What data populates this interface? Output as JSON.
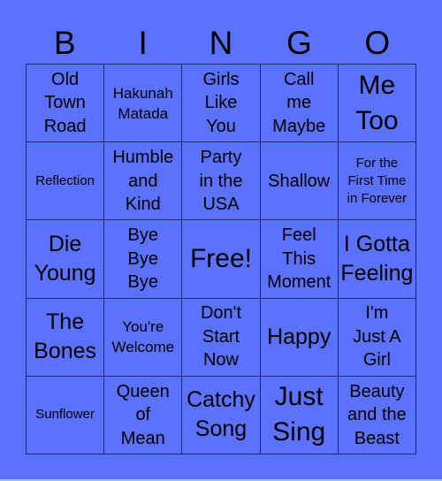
{
  "header": {
    "letters": [
      "B",
      "I",
      "N",
      "G",
      "O"
    ]
  },
  "colors": {
    "background": "#5b72fe",
    "border": "#1b2a6e",
    "text": "#000000"
  },
  "card": {
    "rows": [
      [
        {
          "text": "Old Town Road",
          "lines": [
            "Old",
            "Town",
            "Road"
          ]
        },
        {
          "text": "Hakunah Matada",
          "lines": [
            "Hakunah",
            "Matada"
          ]
        },
        {
          "text": "Girls Like You",
          "lines": [
            "Girls",
            "Like",
            "You"
          ]
        },
        {
          "text": "Call me Maybe",
          "lines": [
            "Call",
            "me",
            "Maybe"
          ]
        },
        {
          "text": "Me Too",
          "lines": [
            "Me",
            "Too"
          ]
        }
      ],
      [
        {
          "text": "Reflection",
          "lines": [
            "Reflection"
          ]
        },
        {
          "text": "Humble and Kind",
          "lines": [
            "Humble",
            "and",
            "Kind"
          ]
        },
        {
          "text": "Party in the USA",
          "lines": [
            "Party",
            "in the",
            "USA"
          ]
        },
        {
          "text": "Shallow",
          "lines": [
            "Shallow"
          ]
        },
        {
          "text": "For the First Time in Forever",
          "lines": [
            "For the",
            "First Time",
            "in Forever"
          ]
        }
      ],
      [
        {
          "text": "Die Young",
          "lines": [
            "Die",
            "Young"
          ]
        },
        {
          "text": "Bye Bye Bye",
          "lines": [
            "Bye",
            "Bye",
            "Bye"
          ]
        },
        {
          "text": "Free!",
          "lines": [
            "Free!"
          ]
        },
        {
          "text": "Feel This Moment",
          "lines": [
            "Feel",
            "This",
            "Moment"
          ]
        },
        {
          "text": "I Gotta Feeling",
          "lines": [
            "I Gotta",
            "Feeling"
          ]
        }
      ],
      [
        {
          "text": "The Bones",
          "lines": [
            "The",
            "Bones"
          ]
        },
        {
          "text": "You're Welcome",
          "lines": [
            "You're",
            "Welcome"
          ]
        },
        {
          "text": "Don't Start Now",
          "lines": [
            "Don't",
            "Start",
            "Now"
          ]
        },
        {
          "text": "Happy",
          "lines": [
            "Happy"
          ]
        },
        {
          "text": "I'm Just A Girl",
          "lines": [
            "I'm",
            "Just A",
            "Girl"
          ]
        }
      ],
      [
        {
          "text": "Sunflower",
          "lines": [
            "Sunflower"
          ]
        },
        {
          "text": "Queen of Mean",
          "lines": [
            "Queen",
            "of",
            "Mean"
          ]
        },
        {
          "text": "Catchy Song",
          "lines": [
            "Catchy",
            "Song"
          ]
        },
        {
          "text": "Just Sing",
          "lines": [
            "Just",
            "Sing"
          ]
        },
        {
          "text": "Beauty and the Beast",
          "lines": [
            "Beauty",
            "and the",
            "Beast"
          ]
        }
      ]
    ]
  }
}
